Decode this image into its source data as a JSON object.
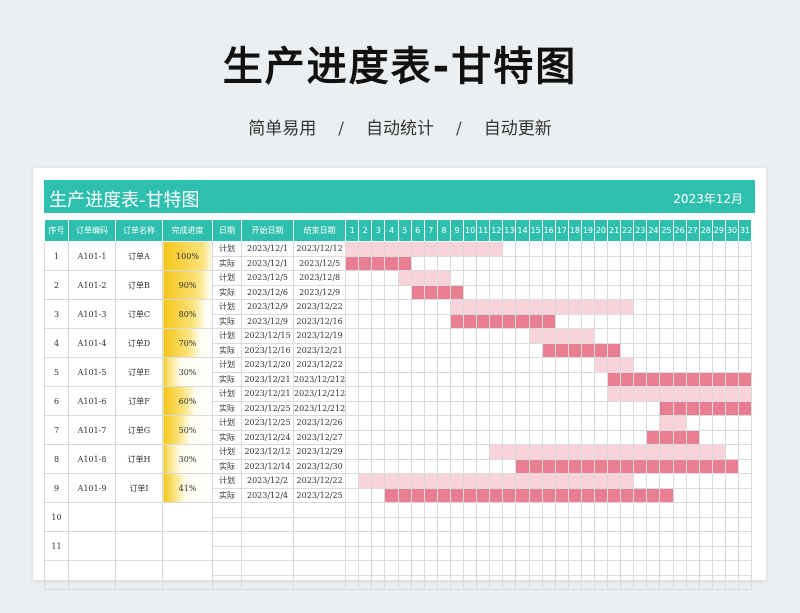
{
  "hero": {
    "title": "生产进度表-甘特图",
    "tags": [
      "简单易用",
      "自动统计",
      "自动更新"
    ],
    "separator": "/"
  },
  "sheet": {
    "title": "生产进度表-甘特图",
    "month": "2023年12月",
    "headers": [
      "序号",
      "订单编码",
      "订单名称",
      "完成进度",
      "日期",
      "开始日期",
      "结束日期"
    ],
    "days": 31,
    "plan_label": "计划",
    "actual_label": "实际",
    "colors": {
      "header": "#2fbfae",
      "plan": "#fad3da",
      "actual": "#e97e92",
      "progress": "#f5c518"
    },
    "rows": [
      {
        "no": "1",
        "code": "A101-1",
        "name": "订单A",
        "progress": "100%",
        "pct": 1.0,
        "plan_start": "2023/12/1",
        "plan_end": "2023/12/12",
        "act_start": "2023/12/1",
        "act_end": "2023/12/5",
        "plan_days": [
          1,
          12
        ],
        "act_days": [
          1,
          5
        ]
      },
      {
        "no": "2",
        "code": "A101-2",
        "name": "订单B",
        "progress": "90%",
        "pct": 0.9,
        "plan_start": "2023/12/5",
        "plan_end": "2023/12/8",
        "act_start": "2023/12/6",
        "act_end": "2023/12/9",
        "plan_days": [
          5,
          8
        ],
        "act_days": [
          6,
          9
        ]
      },
      {
        "no": "3",
        "code": "A101-3",
        "name": "订单C",
        "progress": "80%",
        "pct": 0.8,
        "plan_start": "2023/12/9",
        "plan_end": "2023/12/22",
        "act_start": "2023/12/9",
        "act_end": "2023/12/16",
        "plan_days": [
          9,
          22
        ],
        "act_days": [
          9,
          16
        ]
      },
      {
        "no": "4",
        "code": "A101-4",
        "name": "订单D",
        "progress": "70%",
        "pct": 0.7,
        "plan_start": "2023/12/15",
        "plan_end": "2023/12/19",
        "act_start": "2023/12/16",
        "act_end": "2023/12/21",
        "plan_days": [
          15,
          19
        ],
        "act_days": [
          16,
          21
        ]
      },
      {
        "no": "5",
        "code": "A101-5",
        "name": "订单E",
        "progress": "30%",
        "pct": 0.3,
        "plan_start": "2023/12/20",
        "plan_end": "2023/12/22",
        "act_start": "2023/12/21",
        "act_end": "2023/12/212",
        "plan_days": [
          20,
          22
        ],
        "act_days": [
          21,
          31
        ]
      },
      {
        "no": "6",
        "code": "A101-6",
        "name": "订单F",
        "progress": "60%",
        "pct": 0.6,
        "plan_start": "2023/12/21",
        "plan_end": "2023/12/212",
        "act_start": "2023/12/25",
        "act_end": "2023/12/212",
        "plan_days": [
          21,
          31
        ],
        "act_days": [
          25,
          31
        ]
      },
      {
        "no": "7",
        "code": "A101-7",
        "name": "订单G",
        "progress": "50%",
        "pct": 0.5,
        "plan_start": "2023/12/25",
        "plan_end": "2023/12/26",
        "act_start": "2023/12/24",
        "act_end": "2023/12/27",
        "plan_days": [
          25,
          26
        ],
        "act_days": [
          24,
          27
        ]
      },
      {
        "no": "8",
        "code": "A101-8",
        "name": "订单H",
        "progress": "30%",
        "pct": 0.3,
        "plan_start": "2023/12/12",
        "plan_end": "2023/12/29",
        "act_start": "2023/12/14",
        "act_end": "2023/12/30",
        "plan_days": [
          12,
          29
        ],
        "act_days": [
          14,
          30
        ]
      },
      {
        "no": "9",
        "code": "A101-9",
        "name": "订单I",
        "progress": "41%",
        "pct": 0.41,
        "plan_start": "2023/12/2",
        "plan_end": "2023/12/22",
        "act_start": "2023/12/4",
        "act_end": "2023/12/25",
        "plan_days": [
          2,
          22
        ],
        "act_days": [
          4,
          25
        ]
      },
      {
        "no": "10",
        "code": "",
        "name": "",
        "progress": "",
        "pct": 0,
        "plan_start": "",
        "plan_end": "",
        "act_start": "",
        "act_end": "",
        "plan_days": null,
        "act_days": null
      },
      {
        "no": "11",
        "code": "",
        "name": "",
        "progress": "",
        "pct": 0,
        "plan_start": "",
        "plan_end": "",
        "act_start": "",
        "act_end": "",
        "plan_days": null,
        "act_days": null
      },
      {
        "no": "",
        "code": "",
        "name": "",
        "progress": "",
        "pct": 0,
        "plan_start": "",
        "plan_end": "",
        "act_start": "",
        "act_end": "",
        "plan_days": null,
        "act_days": null
      }
    ]
  }
}
